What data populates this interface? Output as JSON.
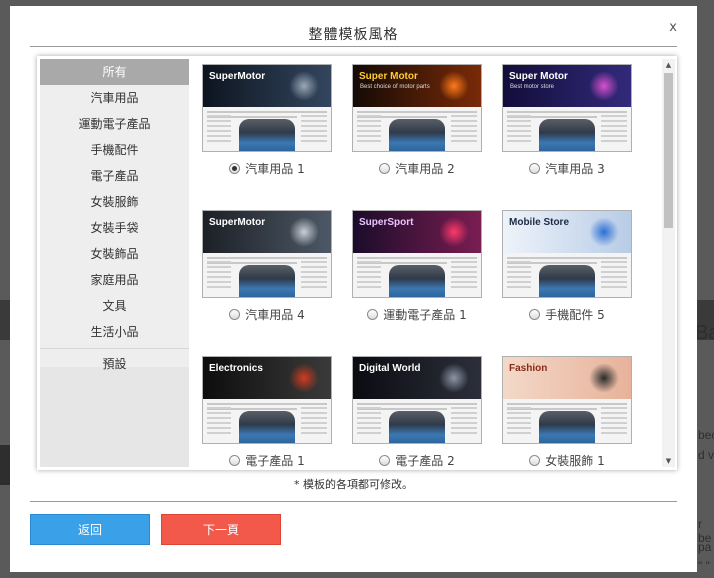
{
  "modal": {
    "title": "整體模板風格",
    "close": "x",
    "note": "* 模板的各項都可修改。"
  },
  "categories": [
    {
      "label": "所有",
      "active": true
    },
    {
      "label": "汽車用品"
    },
    {
      "label": "運動電子產品"
    },
    {
      "label": "手機配件"
    },
    {
      "label": "電子產品"
    },
    {
      "label": "女裝服飾"
    },
    {
      "label": "女裝手袋"
    },
    {
      "label": "女裝飾品"
    },
    {
      "label": "家庭用品"
    },
    {
      "label": "文具"
    },
    {
      "label": "生活小品"
    },
    {
      "label": "預設"
    }
  ],
  "templates": [
    {
      "label": "汽車用品 1",
      "checked": true,
      "banner_title": "SuperMotor",
      "banner_sub": "",
      "banner_colors": [
        "#0d1420",
        "#33465e"
      ],
      "title_color": "#ffffff",
      "orb": "#9aa7b6"
    },
    {
      "label": "汽車用品 2",
      "checked": false,
      "banner_title": "Super Motor",
      "banner_sub": "Best choice of motor parts",
      "banner_colors": [
        "#140a05",
        "#7a2a08"
      ],
      "title_color": "#ffcc33",
      "orb": "#ff7a1a"
    },
    {
      "label": "汽車用品 3",
      "checked": false,
      "banner_title": "Super Motor",
      "banner_sub": "Best motor store",
      "banner_colors": [
        "#120d3a",
        "#322a7a"
      ],
      "title_color": "#ffffff",
      "orb": "#d84fd0"
    },
    {
      "label": "汽車用品 4",
      "checked": false,
      "banner_title": "SuperMotor",
      "banner_sub": "",
      "banner_colors": [
        "#1c2026",
        "#4d5866"
      ],
      "title_color": "#ffffff",
      "orb": "#c9ced6"
    },
    {
      "label": "運動電子產品 1",
      "checked": false,
      "banner_title": "SuperSport",
      "banner_sub": "",
      "banner_colors": [
        "#1a0c2a",
        "#7a1d52"
      ],
      "title_color": "#e9c4ff",
      "orb": "#ff3a6a"
    },
    {
      "label": "手機配件 5",
      "checked": false,
      "banner_title": "Mobile Store",
      "banner_sub": "",
      "banner_colors": [
        "#eef3fa",
        "#b8cce6"
      ],
      "title_color": "#1d2b44",
      "orb": "#2b6fd6"
    },
    {
      "label": "電子產品 1",
      "checked": false,
      "banner_title": "Electronics",
      "banner_sub": "",
      "banner_colors": [
        "#0d0d0d",
        "#3a3a3a"
      ],
      "title_color": "#ffffff",
      "orb": "#d23b1f"
    },
    {
      "label": "電子產品 2",
      "checked": false,
      "banner_title": "Digital World",
      "banner_sub": "",
      "banner_colors": [
        "#0b0b12",
        "#2c2f3a"
      ],
      "title_color": "#ffffff",
      "orb": "#8d96a6"
    },
    {
      "label": "女裝服飾 1",
      "checked": false,
      "banner_title": "Fashion",
      "banner_sub": "",
      "banner_colors": [
        "#f3d9c8",
        "#e7b29a"
      ],
      "title_color": "#8a2a1a",
      "orb": "#2a2a2a"
    }
  ],
  "buttons": {
    "back": "返回",
    "next": "下一頁"
  },
  "background_text": {
    "right1": "Ba",
    "right2": "bec",
    "right3": "d v",
    "right4": "r be",
    "right5": "pa",
    "right6": "\" \""
  }
}
